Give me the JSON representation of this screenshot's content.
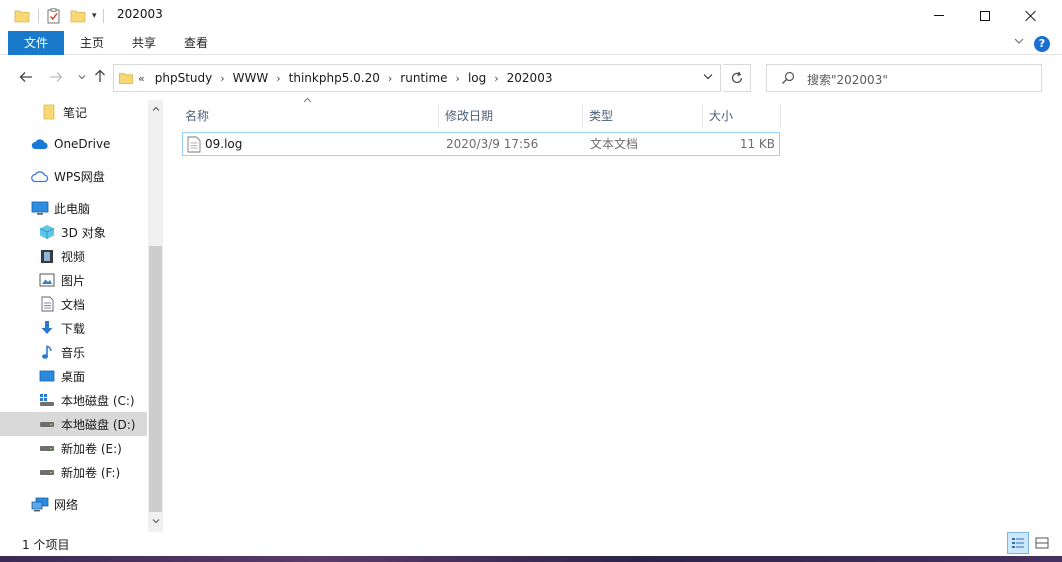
{
  "window": {
    "title": "202003",
    "qat_dropdown": "▾"
  },
  "ribbon": {
    "tabs": [
      "文件",
      "主页",
      "共享",
      "查看"
    ],
    "expand_icon": "chevron-down",
    "help": "?"
  },
  "address": {
    "lead": "«",
    "breadcrumbs": [
      "phpStudy",
      "WWW",
      "thinkphp5.0.20",
      "runtime",
      "log",
      "202003"
    ],
    "separator": "›"
  },
  "search": {
    "placeholder": "搜索\"202003\""
  },
  "sidebar": {
    "items": [
      {
        "label": "笔记",
        "icon": "folder-icon"
      },
      {
        "label": "OneDrive",
        "icon": "cloud-icon"
      },
      {
        "label": "WPS网盘",
        "icon": "cloud-outline-icon"
      },
      {
        "label": "此电脑",
        "icon": "computer-icon"
      },
      {
        "label": "3D 对象",
        "icon": "cube-icon"
      },
      {
        "label": "视频",
        "icon": "video-icon"
      },
      {
        "label": "图片",
        "icon": "picture-icon"
      },
      {
        "label": "文档",
        "icon": "document-icon"
      },
      {
        "label": "下载",
        "icon": "download-icon"
      },
      {
        "label": "音乐",
        "icon": "music-icon"
      },
      {
        "label": "桌面",
        "icon": "desktop-icon"
      },
      {
        "label": "本地磁盘 (C:)",
        "icon": "system-drive-icon"
      },
      {
        "label": "本地磁盘 (D:)",
        "icon": "drive-icon",
        "selected": true
      },
      {
        "label": "新加卷 (E:)",
        "icon": "drive-icon"
      },
      {
        "label": "新加卷 (F:)",
        "icon": "drive-icon"
      },
      {
        "label": "网络",
        "icon": "network-icon"
      }
    ]
  },
  "file_list": {
    "columns": {
      "name": "名称",
      "date": "修改日期",
      "type": "类型",
      "size": "大小"
    },
    "rows": [
      {
        "name": "09.log",
        "date": "2020/3/9 17:56",
        "type": "文本文档",
        "size": "11 KB"
      }
    ]
  },
  "status": {
    "item_count": "1 个项目"
  },
  "colors": {
    "accent": "#1979ca",
    "selection_border": "#99d1ff",
    "column_header_text": "#4c607a",
    "folder": "#f8d775"
  }
}
